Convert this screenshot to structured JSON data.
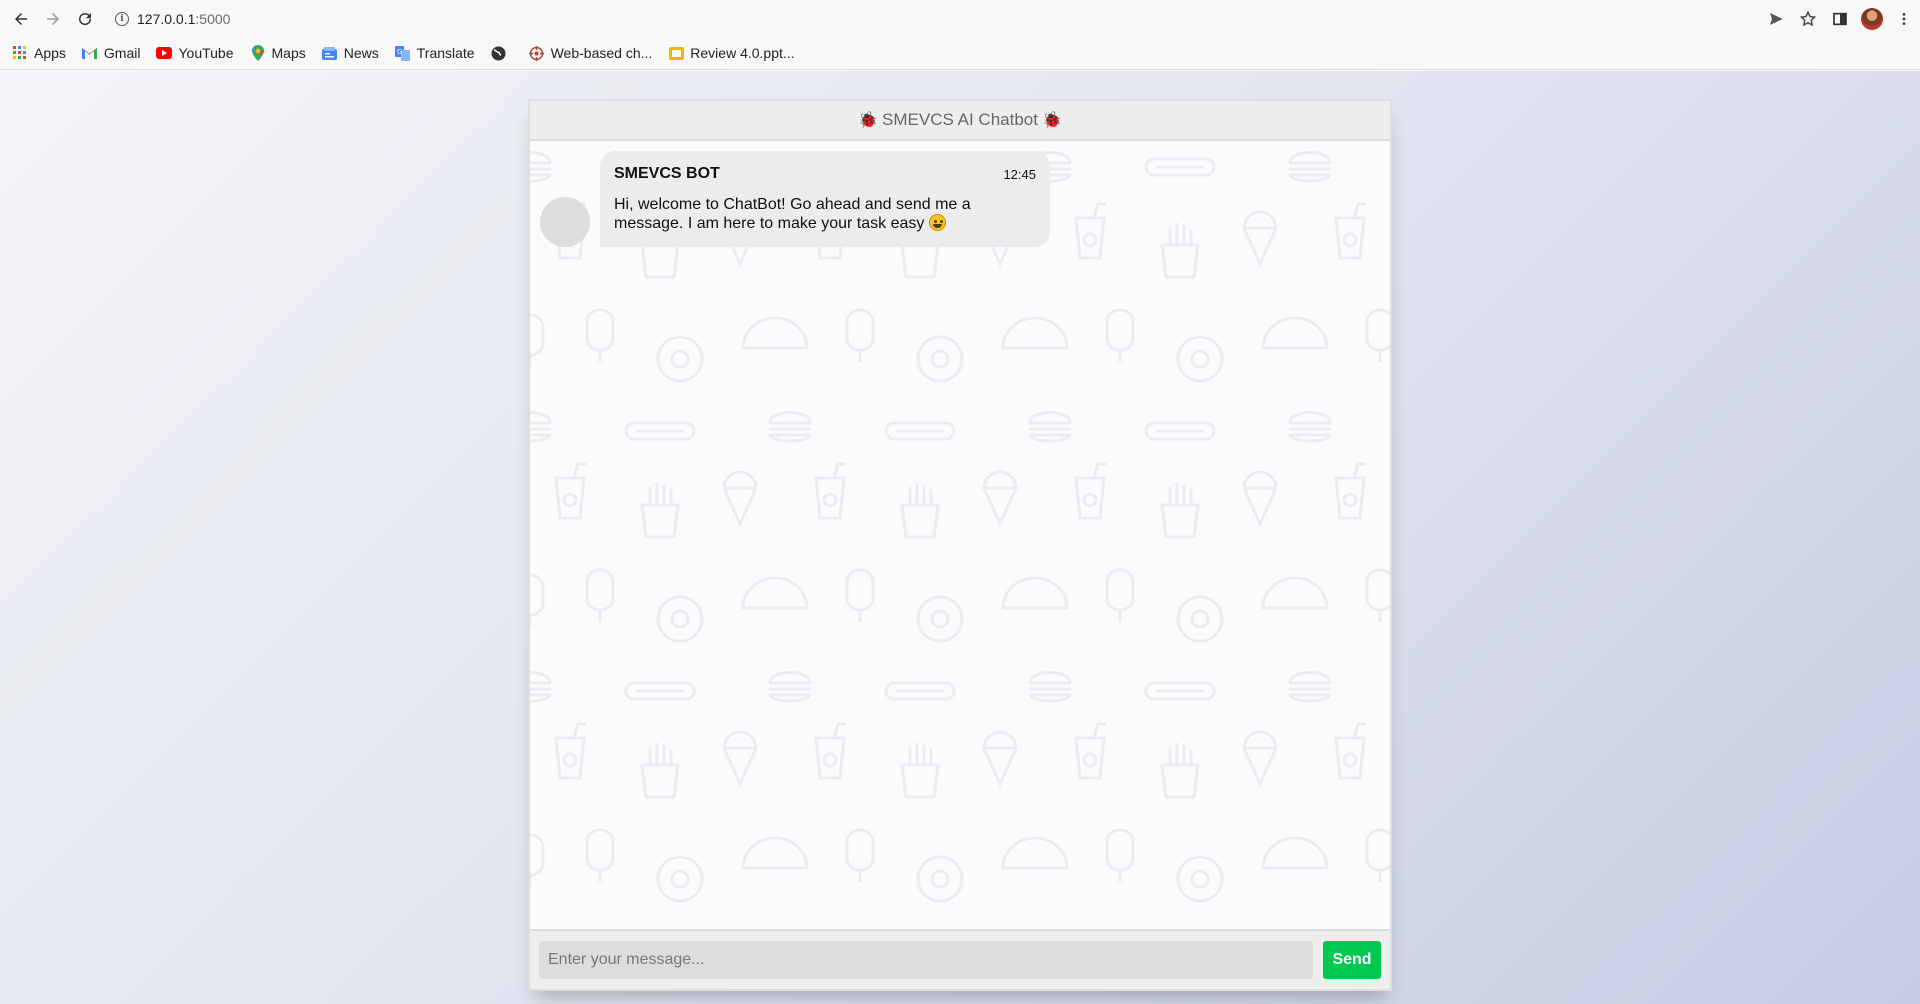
{
  "browser": {
    "url_host": "127.0.0.1",
    "url_port": ":5000",
    "bookmarks": [
      {
        "label": "Apps",
        "icon": "apps-grid-icon"
      },
      {
        "label": "Gmail",
        "icon": "gmail-icon"
      },
      {
        "label": "YouTube",
        "icon": "youtube-icon"
      },
      {
        "label": "Maps",
        "icon": "maps-icon"
      },
      {
        "label": "News",
        "icon": "news-icon"
      },
      {
        "label": "Translate",
        "icon": "translate-icon"
      },
      {
        "label": "",
        "icon": "globe-icon"
      },
      {
        "label": "Web-based ch...",
        "icon": "web-icon"
      },
      {
        "label": "Review 4.0.ppt...",
        "icon": "slides-icon"
      }
    ]
  },
  "chat": {
    "title": "SMEVCS AI Chatbot",
    "header_icon": "bug-icon",
    "messages": [
      {
        "sender": "SMEVCS BOT",
        "time": "12:45",
        "text": "Hi, welcome to ChatBot! Go ahead and send me a message. I am here to make your task easy"
      }
    ],
    "input_placeholder": "Enter your message...",
    "send_label": "Send"
  },
  "colors": {
    "send_button": "#00c851",
    "bubble": "#ececec",
    "header": "#eeeeee"
  }
}
